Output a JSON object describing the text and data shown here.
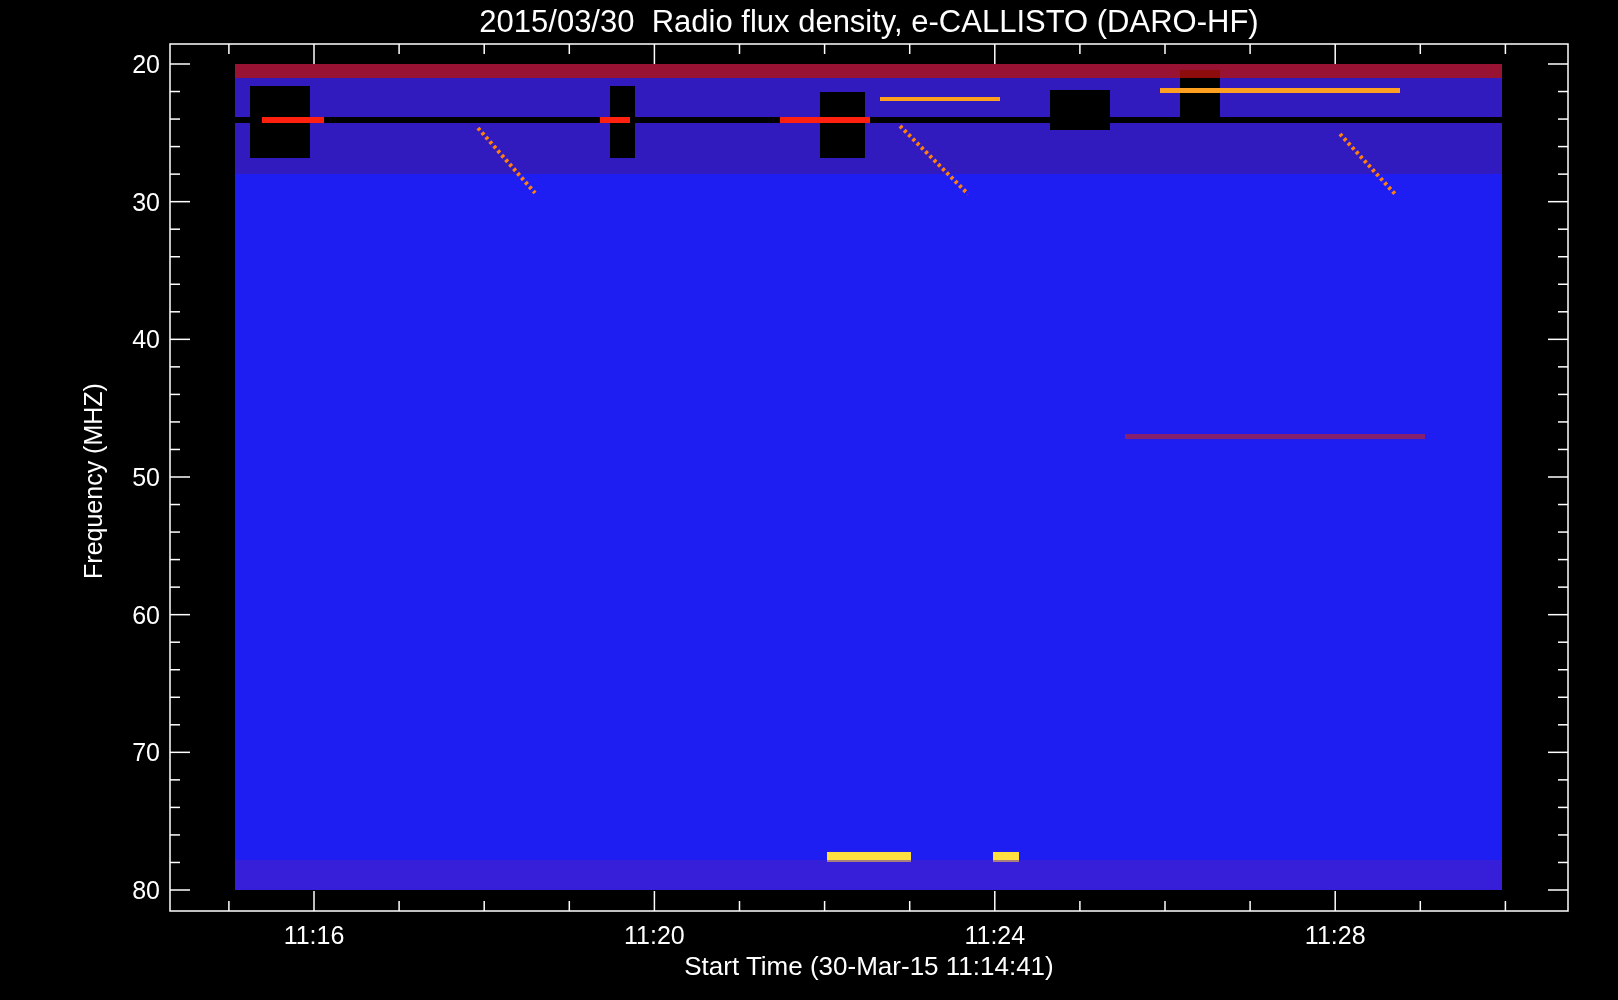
{
  "title": "2015/03/30  Radio flux density, e-CALLISTO (DARO-HF)",
  "y_axis": {
    "label": "Frequency (MHZ)",
    "ticks": [
      "20",
      "30",
      "40",
      "50",
      "60",
      "70",
      "80"
    ]
  },
  "x_axis": {
    "label": "Start Time (30-Mar-15 11:14:41)",
    "ticks": [
      "11:16",
      "11:20",
      "11:24",
      "11:28"
    ]
  }
}
